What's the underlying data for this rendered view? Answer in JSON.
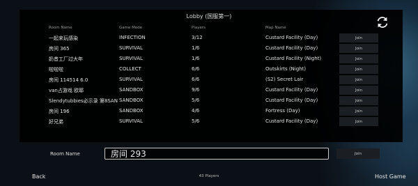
{
  "lobby": {
    "title": "Lobby (国服第一)",
    "columns": {
      "name": "Room Name",
      "mode": "Game Mode",
      "players": "Players",
      "map": "Map Name"
    },
    "rows": [
      {
        "name": "一起来玩感染",
        "mode": "INFECTION",
        "players": "3/12",
        "map": "Custard Facility (Day)",
        "join": "Join"
      },
      {
        "name": "房间 365",
        "mode": "SURVIVAL",
        "players": "1/6",
        "map": "Custard Facility (Day)",
        "join": "Join"
      },
      {
        "name": "奶昔工厂过大年",
        "mode": "SURVIVAL",
        "players": "1/6",
        "map": "Custard Facility (Night)",
        "join": "Join"
      },
      {
        "name": "啦啦啦",
        "mode": "COLLECT",
        "players": "6/6",
        "map": "Outskirts (Night)",
        "join": "Join"
      },
      {
        "name": "房间 114514  6.0",
        "mode": "SURVIVAL",
        "players": "6/6",
        "map": "(S2) Secret Lair",
        "join": "Join"
      },
      {
        "name": "van占游戏 欧耶",
        "mode": "SANDBOX",
        "players": "9/6",
        "map": "Custard Facility (Day)",
        "join": "Join"
      },
      {
        "name": "Slendytubbies必示录 第8SANDBOX",
        "mode": "SANDBOX",
        "players": "5/6",
        "map": "Custard Facility (Day)",
        "join": "Join"
      },
      {
        "name": "房间 196",
        "mode": "SANDBOX",
        "players": "4/6",
        "map": "Fortress (Day)",
        "join": "Join"
      },
      {
        "name": "好兄弟",
        "mode": "SURVIVAL",
        "players": "5/6",
        "map": "Custard Facility (Day)",
        "join": "Join"
      }
    ],
    "refresh_icon": "refresh-icon"
  },
  "room_name": {
    "label": "Room Name",
    "value": "房间 293",
    "join": "Join"
  },
  "footer": {
    "back": "Back",
    "player_count": "43 Players",
    "host": "Host Game"
  }
}
